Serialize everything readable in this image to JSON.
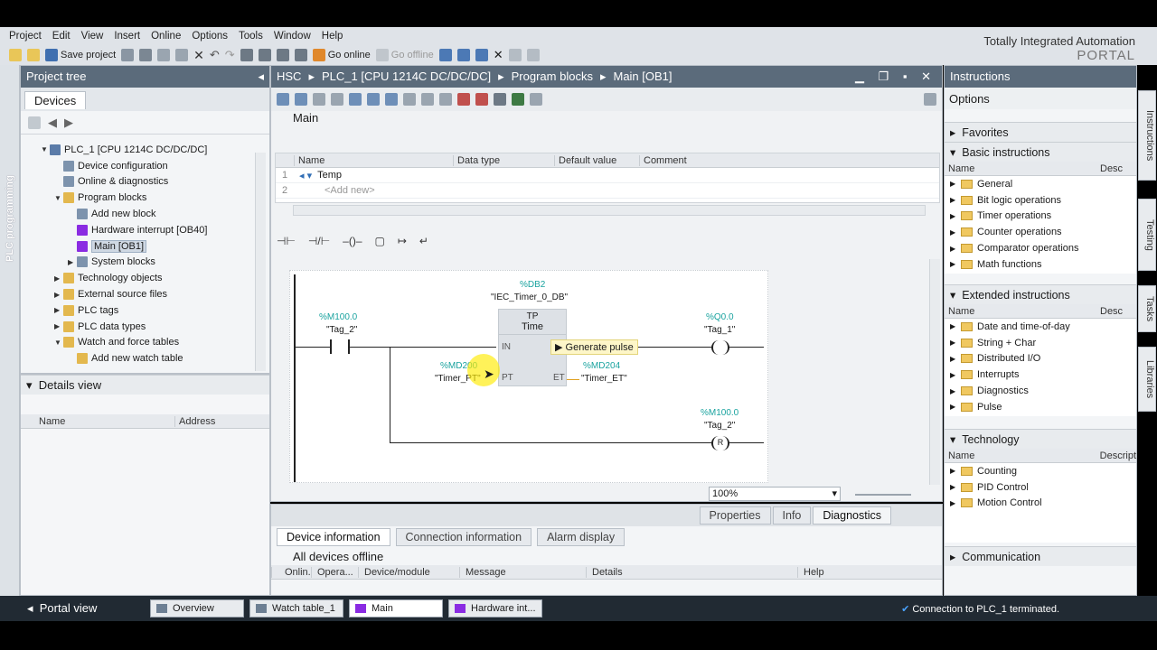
{
  "menu": [
    "Project",
    "Edit",
    "View",
    "Insert",
    "Online",
    "Options",
    "Tools",
    "Window",
    "Help"
  ],
  "toolbar": {
    "save_label": "Save project",
    "go_online": "Go online",
    "go_offline": "Go offline"
  },
  "brand": {
    "line1": "Totally Integrated Automation",
    "line2": "PORTAL"
  },
  "left_strip_label": "PLC programming",
  "project_tree": {
    "title": "Project tree",
    "tab": "Devices",
    "items": [
      {
        "label": "PLC_1 [CPU 1214C DC/DC/DC]",
        "indent": 0,
        "exp": "open"
      },
      {
        "label": "Device configuration",
        "indent": 1,
        "exp": ""
      },
      {
        "label": "Online & diagnostics",
        "indent": 1,
        "exp": ""
      },
      {
        "label": "Program blocks",
        "indent": 1,
        "exp": "open"
      },
      {
        "label": "Add new block",
        "indent": 2,
        "exp": ""
      },
      {
        "label": "Hardware interrupt [OB40]",
        "indent": 2,
        "exp": ""
      },
      {
        "label": "Main [OB1]",
        "indent": 2,
        "exp": "",
        "selected": true
      },
      {
        "label": "System blocks",
        "indent": 2,
        "exp": "closed"
      },
      {
        "label": "Technology objects",
        "indent": 1,
        "exp": "closed"
      },
      {
        "label": "External source files",
        "indent": 1,
        "exp": "closed"
      },
      {
        "label": "PLC tags",
        "indent": 1,
        "exp": "closed"
      },
      {
        "label": "PLC data types",
        "indent": 1,
        "exp": "closed"
      },
      {
        "label": "Watch and force tables",
        "indent": 1,
        "exp": "open"
      },
      {
        "label": "Add new watch table",
        "indent": 2,
        "exp": ""
      }
    ]
  },
  "details_view": {
    "title": "Details view",
    "col_name": "Name",
    "col_address": "Address"
  },
  "editor": {
    "breadcrumb": [
      "HSC",
      "PLC_1 [CPU 1214C DC/DC/DC]",
      "Program blocks",
      "Main [OB1]"
    ],
    "block_name": "Main",
    "interface_cols": [
      "Name",
      "Data type",
      "Default value",
      "Comment"
    ],
    "interface_rows": [
      {
        "num": "1",
        "name": "Temp"
      },
      {
        "num": "2",
        "name": "<Add new>"
      }
    ],
    "zoom": "100%",
    "ladder": {
      "db_addr": "%DB2",
      "db_name": "\"IEC_Timer_0_DB\"",
      "box_type": "TP",
      "box_sub": "Time",
      "contact_addr": "%M100.0",
      "contact_tag": "\"Tag_2\"",
      "pin_in": "IN",
      "pin_pt": "PT",
      "pin_et": "ET",
      "pt_addr": "%MD200",
      "pt_tag": "\"Timer_PT\"",
      "et_addr": "%MD204",
      "et_tag": "\"Timer_ET\"",
      "tooltip": "Generate pulse",
      "coil_addr": "%Q0.0",
      "coil_tag": "\"Tag_1\"",
      "reset_addr": "%M100.0",
      "reset_tag": "\"Tag_2\"",
      "reset_letter": "R"
    }
  },
  "inspector": {
    "tabs": [
      "Properties",
      "Info",
      "Diagnostics"
    ],
    "subtabs": [
      "Device information",
      "Connection information",
      "Alarm display"
    ],
    "status": "All devices offline",
    "cols": [
      "Onlin...",
      "Opera...",
      "Device/module",
      "Message",
      "Details",
      "Help"
    ]
  },
  "instructions": {
    "title": "Instructions",
    "options": "Options",
    "favorites": "Favorites",
    "basic": {
      "title": "Basic instructions",
      "col_name": "Name",
      "col_desc": "Desc",
      "items": [
        "General",
        "Bit logic operations",
        "Timer operations",
        "Counter operations",
        "Comparator operations",
        "Math functions"
      ]
    },
    "extended": {
      "title": "Extended instructions",
      "col_name": "Name",
      "col_desc": "Desc",
      "items": [
        "Date and time-of-day",
        "String + Char",
        "Distributed I/O",
        "Interrupts",
        "Diagnostics",
        "Pulse"
      ]
    },
    "technology": {
      "title": "Technology",
      "col_name": "Name",
      "col_desc": "Descript",
      "items": [
        "Counting",
        "PID Control",
        "Motion Control"
      ]
    },
    "communication": "Communication"
  },
  "side_tabs": [
    "Instructions",
    "Testing",
    "Tasks",
    "Libraries"
  ],
  "taskbar": {
    "portal_view": "Portal view",
    "tasks": [
      "Overview",
      "Watch table_1",
      "Main",
      "Hardware int..."
    ],
    "status": "Connection to PLC_1 terminated."
  },
  "colors": {
    "accent_teal": "#1aa39f",
    "title_bar": "#5b6b7b",
    "block_purple": "#8a2be2"
  }
}
